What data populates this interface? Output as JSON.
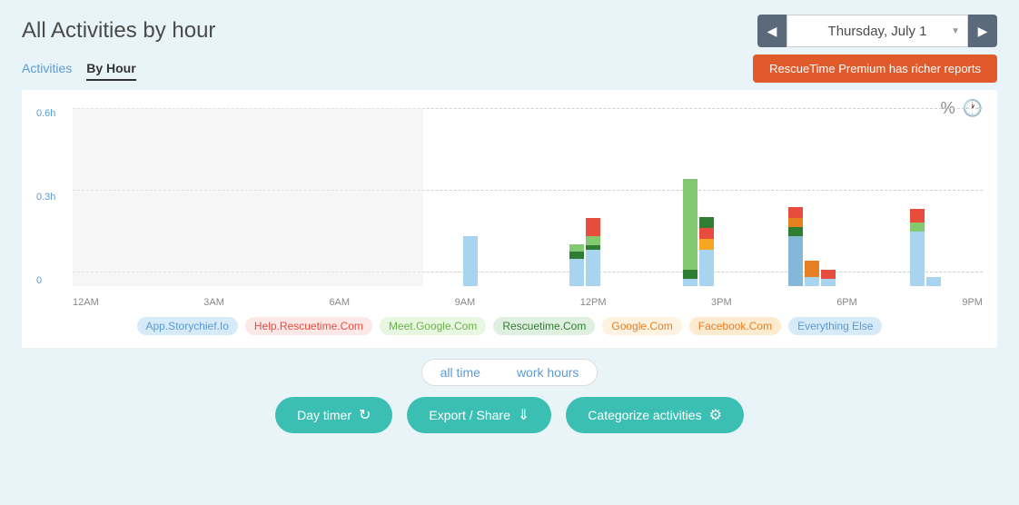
{
  "header": {
    "title": "All Activities by hour",
    "date": "Thursday, July 1"
  },
  "tabs": [
    {
      "label": "Activities",
      "active": false
    },
    {
      "label": "By Hour",
      "active": true
    }
  ],
  "premium_btn": "RescueTime Premium has richer reports",
  "chart": {
    "y_labels": [
      "0.6h",
      "0.3h",
      "0"
    ],
    "x_labels": [
      "12AM",
      "3AM",
      "6AM",
      "9AM",
      "12PM",
      "3PM",
      "6PM",
      "9PM"
    ],
    "pct_icon": "%",
    "clock_icon": "🕐"
  },
  "legend": [
    {
      "label": "App.Storychief.Io",
      "color": "#a8d4f0",
      "bg": "#d6eaf8"
    },
    {
      "label": "Help.Rescuetime.Com",
      "color": "#e74c3c",
      "bg": "#fde8e8"
    },
    {
      "label": "Meet.Google.Com",
      "color": "#82c972",
      "bg": "#e8f8e0"
    },
    {
      "label": "Rescuetime.Com",
      "color": "#2e7d32",
      "bg": "#e0f0e0"
    },
    {
      "label": "Google.Com",
      "color": "#f5a623",
      "bg": "#fdf3e0"
    },
    {
      "label": "Facebook.Com",
      "color": "#e67e22",
      "bg": "#fdebd0"
    },
    {
      "label": "Everything Else",
      "color": "#85b8d8",
      "bg": "#d6eaf8"
    }
  ],
  "time_filter": {
    "options": [
      "all time",
      "work hours"
    ]
  },
  "action_buttons": [
    {
      "label": "Day timer",
      "icon": "↻"
    },
    {
      "label": "Export / Share",
      "icon": "⇓"
    },
    {
      "label": "Categorize activities",
      "icon": "⚙"
    }
  ]
}
